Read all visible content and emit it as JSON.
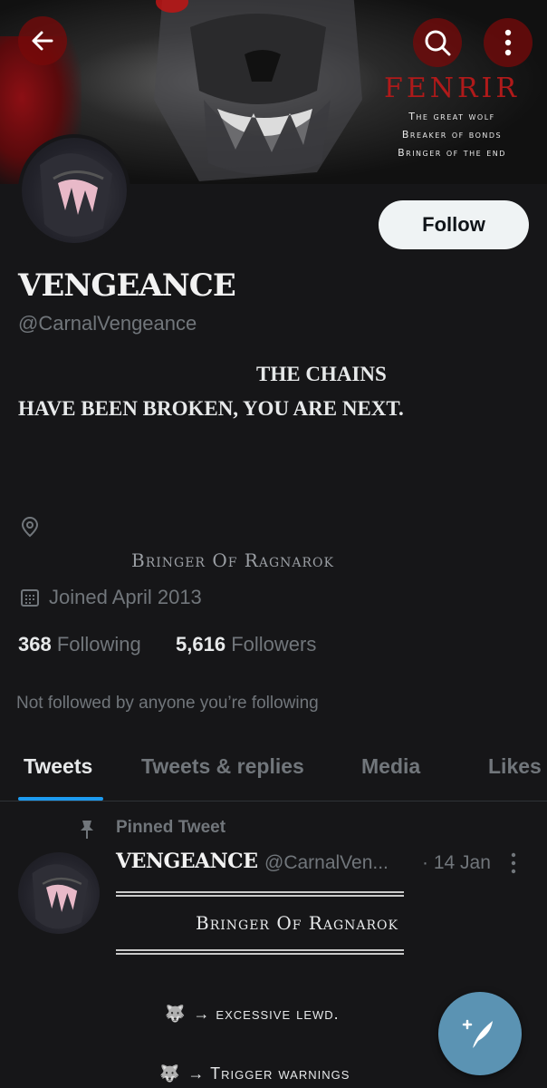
{
  "banner": {
    "title": "FENRIR",
    "lines": [
      "The great wolf",
      "Breaker of bonds",
      "Bringer of the end"
    ]
  },
  "icons": {
    "back": "arrow-left-icon",
    "search": "search-icon",
    "more": "more-vertical-icon",
    "location": "location-pin-icon",
    "calendar": "calendar-icon",
    "pin": "pin-icon",
    "compose": "compose-feather-icon"
  },
  "profile": {
    "follow_label": "Follow",
    "name": "VENGEANCE",
    "handle": "@CarnalVengeance",
    "bio_line1": "THE CHAINS",
    "bio_line2": "HAVE BEEN BROKEN, YOU ARE NEXT.",
    "location": "Bringer Of Ragnarok",
    "joined": "Joined April 2013",
    "following_count": "368",
    "following_label": "Following",
    "followers_count": "5,616",
    "followers_label": "Followers",
    "not_followed": "Not followed by anyone you’re following"
  },
  "tabs": [
    {
      "label": "Tweets",
      "active": true
    },
    {
      "label": "Tweets & replies",
      "active": false
    },
    {
      "label": "Media",
      "active": false
    },
    {
      "label": "Likes",
      "active": false
    }
  ],
  "pinned_tweet": {
    "pinned_label": "Pinned Tweet",
    "name": "VENGEANCE",
    "handle": "@CarnalVen...",
    "date": "· 14 Jan",
    "body_title": "Bringer Of Ragnarok",
    "warnings": [
      "→ excessive lewd.",
      "→ Trigger warnings"
    ]
  },
  "colors": {
    "background": "#161618",
    "accent": "#1d9bf0",
    "fenrir_red": "#b01a1a",
    "fab": "#5b93b3"
  }
}
